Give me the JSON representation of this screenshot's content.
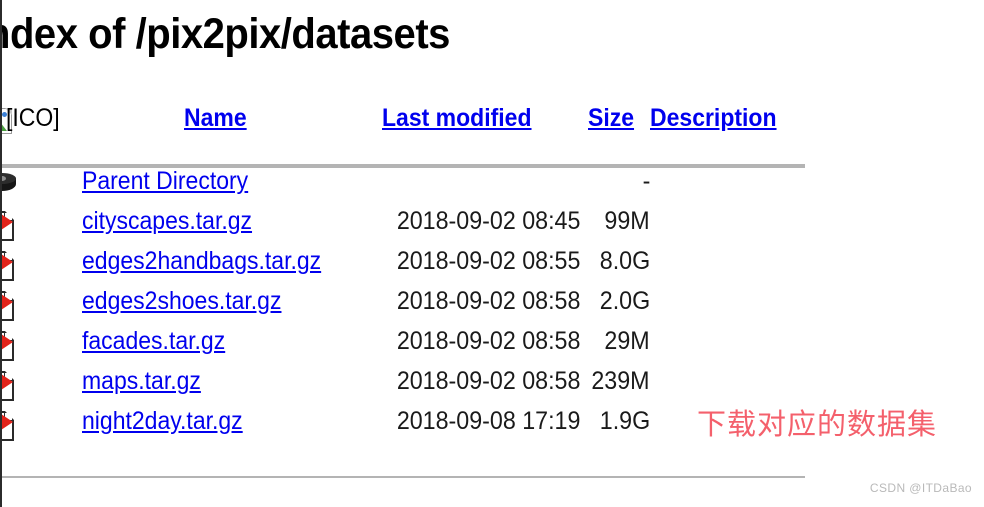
{
  "page": {
    "title": "ndex of /pix2pix/datasets"
  },
  "table": {
    "icon_column_label": "[ICO]",
    "headers": {
      "name": "Name",
      "last_modified": "Last modified",
      "size": "Size",
      "description": "Description"
    },
    "rows": [
      {
        "icon": "parent-directory-icon",
        "name": "Parent Directory",
        "last_modified": "",
        "size": "-",
        "description": ""
      },
      {
        "icon": "broken-image-icon",
        "name": "cityscapes.tar.gz",
        "last_modified": "2018-09-02 08:45",
        "size": "99M",
        "description": ""
      },
      {
        "icon": "broken-image-icon",
        "name": "edges2handbags.tar.gz",
        "last_modified": "2018-09-02 08:55",
        "size": "8.0G",
        "description": ""
      },
      {
        "icon": "broken-image-icon",
        "name": "edges2shoes.tar.gz",
        "last_modified": "2018-09-02 08:58",
        "size": "2.0G",
        "description": ""
      },
      {
        "icon": "broken-image-icon",
        "name": "facades.tar.gz",
        "last_modified": "2018-09-02 08:58",
        "size": "29M",
        "description": ""
      },
      {
        "icon": "broken-image-icon",
        "name": "maps.tar.gz",
        "last_modified": "2018-09-02 08:58",
        "size": "239M",
        "description": ""
      },
      {
        "icon": "broken-image-icon",
        "name": "night2day.tar.gz",
        "last_modified": "2018-09-08 17:19",
        "size": "1.9G",
        "description": ""
      }
    ]
  },
  "annotation": {
    "text": "下载对应的数据集",
    "color": "#f4606c"
  },
  "watermark": {
    "text": "CSDN @ITDaBao",
    "color": "#b9b9b9"
  },
  "colors": {
    "link": "#0000ee",
    "text": "#000000",
    "rule": "#b4b4b4"
  }
}
